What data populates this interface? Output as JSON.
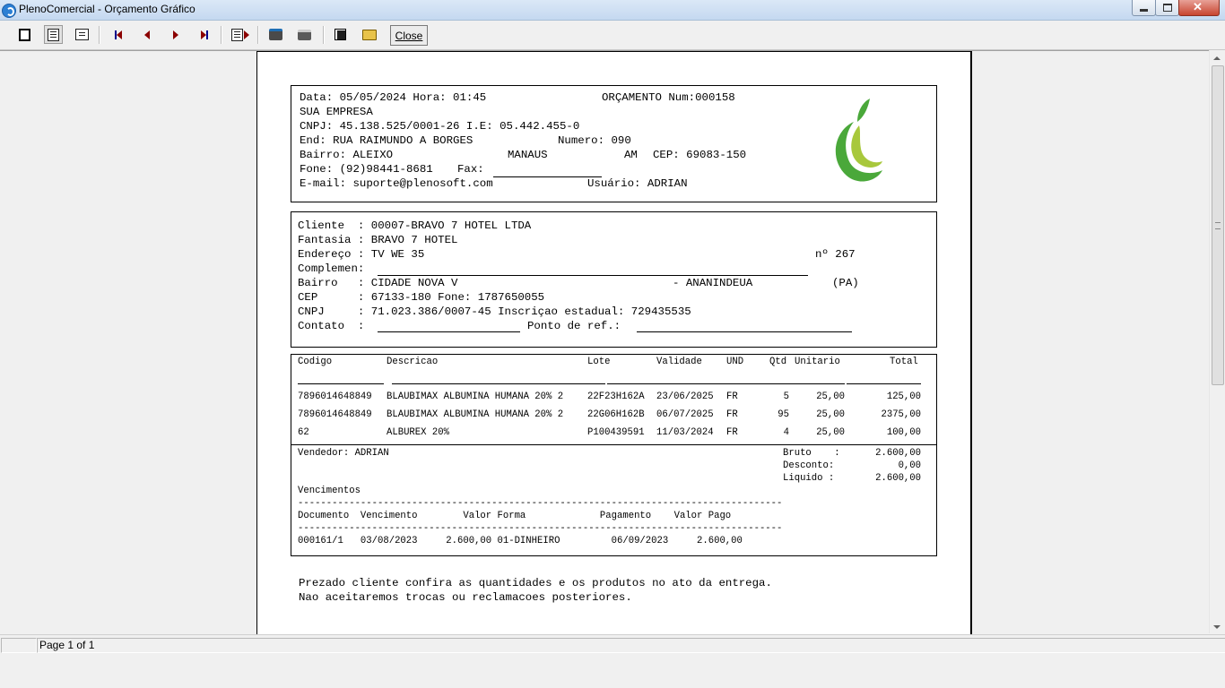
{
  "window": {
    "title": "PlenoComercial - Orçamento Gráfico"
  },
  "toolbar": {
    "close_label": "Close"
  },
  "header": {
    "line1_left": "Data: 05/05/2024 Hora: 01:45",
    "line1_right": "ORÇAMENTO Num:000158",
    "company": "SUA EMPRESA",
    "cnpj": "CNPJ: 45.138.525/0001-26 I.E: 05.442.455-0",
    "address": "End: RUA RAIMUNDO A BORGES",
    "number": "Numero: 090",
    "bairro": "Bairro: ALEIXO",
    "city": "MANAUS",
    "state": "AM",
    "cep": "CEP: 69083-150",
    "phone": "Fone: (92)98441-8681",
    "fax_label": "Fax:",
    "email": "E-mail: suporte@plenosoft.com",
    "user": "Usuário: ADRIAN"
  },
  "client": {
    "name": "Cliente  : 00007-BRAVO 7 HOTEL LTDA",
    "fantasia": "Fantasia : BRAVO 7 HOTEL",
    "endereco": "Endereço : TV WE 35",
    "numero": "nº 267",
    "complemento": "Complemen:",
    "bairro": "Bairro   : CIDADE NOVA V",
    "cidade": "- ANANINDEUA",
    "uf": "(PA)",
    "cep": "CEP      : 67133-180 Fone: 1787650055",
    "cnpj": "CNPJ     : 71.023.386/0007-45 Inscriçao estadual: 729435535",
    "contato": "Contato  :",
    "ponto_ref": "Ponto de ref.:"
  },
  "items": {
    "headers": {
      "codigo": "Codigo",
      "descricao": "Descricao",
      "lote": "Lote",
      "validade": "Validade",
      "und": "UND",
      "qtd": "Qtd",
      "unitario": "Unitario",
      "total": "Total"
    },
    "rows": [
      {
        "codigo": "7896014648849",
        "descricao": "BLAUBIMAX ALBUMINA HUMANA 20% 2",
        "lote": "22F23H162A",
        "validade": "23/06/2025",
        "und": "FR",
        "qtd": "5",
        "unitario": "25,00",
        "total": "125,00"
      },
      {
        "codigo": "7896014648849",
        "descricao": "BLAUBIMAX ALBUMINA HUMANA 20% 2",
        "lote": "22G06H162B",
        "validade": "06/07/2025",
        "und": "FR",
        "qtd": "95",
        "unitario": "25,00",
        "total": "2375,00"
      },
      {
        "codigo": "62",
        "descricao": "ALBUREX 20%",
        "lote": "P100439591",
        "validade": "11/03/2024",
        "und": "FR",
        "qtd": "4",
        "unitario": "25,00",
        "total": "100,00"
      }
    ]
  },
  "totals": {
    "vendedor": "Vendedor: ADRIAN",
    "bruto_label": "Bruto    :",
    "bruto": "2.600,00",
    "desconto_label": "Desconto:",
    "desconto": "0,00",
    "liquido_label": "Liquido :",
    "liquido": "2.600,00"
  },
  "vencimentos": {
    "title": "Vencimentos",
    "dashes": "-------------------------------------------------------------------------------------",
    "header": "Documento  Vencimento        Valor Forma             Pagamento    Valor Pago",
    "row": "000161/1   03/08/2023     2.600,00 01-DINHEIRO         06/09/2023     2.600,00"
  },
  "footer": {
    "line1": "Prezado cliente confira as quantidades e os produtos no ato da entrega.",
    "line2": "Nao aceitaremos trocas ou reclamacoes posteriores."
  },
  "status": {
    "page": "Page 1 of 1"
  },
  "colors": {
    "logo_dark_green": "#4aa83a",
    "logo_light_green": "#a8c83c"
  }
}
